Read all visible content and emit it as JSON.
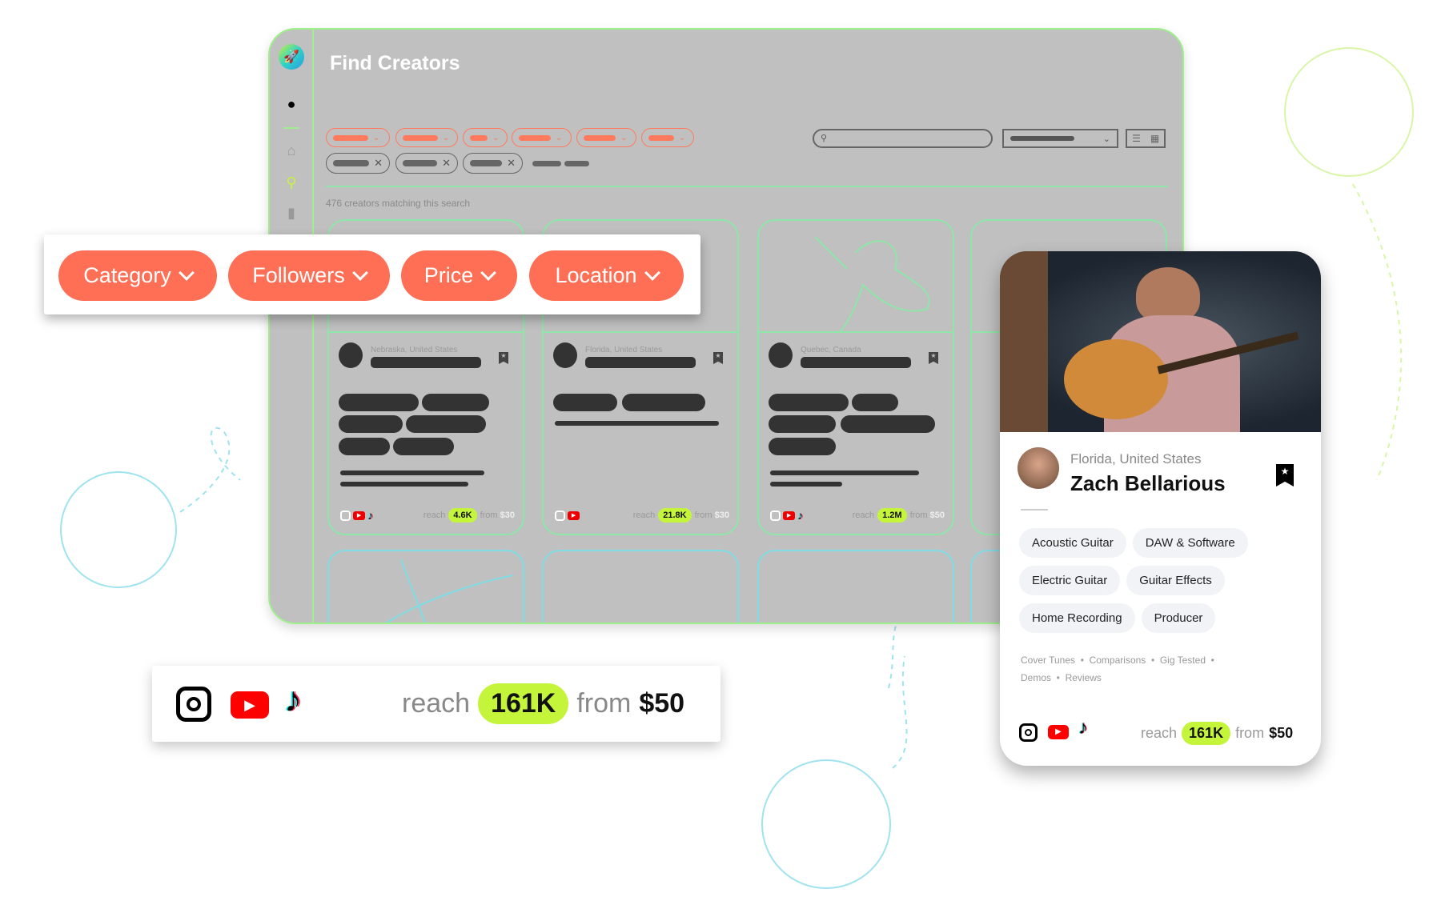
{
  "app": {
    "title": "Find Creators",
    "results_count": "476 creators matching this search"
  },
  "sidebar": {
    "items": [
      {
        "icon": "rocket-logo-icon"
      },
      {
        "icon": "guitar-icon"
      },
      {
        "icon": "home-icon"
      },
      {
        "icon": "search-icon"
      },
      {
        "icon": "bookmark-icon"
      }
    ]
  },
  "filters": [
    {
      "label": "Category"
    },
    {
      "label": "Followers"
    },
    {
      "label": "Price"
    },
    {
      "label": "Location"
    }
  ],
  "grid_cards": [
    {
      "location": "Nebraska, United States",
      "reach": "4.6K",
      "from_label": "from",
      "price": "$30",
      "reach_label": "reach",
      "platforms": [
        "instagram",
        "youtube",
        "tiktok"
      ]
    },
    {
      "location": "Florida, United States",
      "reach": "21.8K",
      "from_label": "from",
      "price": "$30",
      "reach_label": "reach",
      "platforms": [
        "instagram",
        "youtube"
      ]
    },
    {
      "location": "Quebec, Canada",
      "reach": "1.2M",
      "from_label": "from",
      "price": "$50",
      "reach_label": "reach",
      "platforms": [
        "instagram",
        "youtube",
        "tiktok"
      ]
    }
  ],
  "social_callout": {
    "reach_label": "reach",
    "reach": "161K",
    "from_label": "from",
    "price": "$50",
    "platforms": [
      "instagram",
      "youtube",
      "tiktok"
    ]
  },
  "profile": {
    "location": "Florida, United States",
    "name": "Zach Bellarious",
    "tags": [
      "Acoustic Guitar",
      "DAW & Software",
      "Electric Guitar",
      "Guitar Effects",
      "Home Recording",
      "Producer"
    ],
    "content_types": [
      "Cover Tunes",
      "Comparisons",
      "Gig Tested",
      "Demos",
      "Reviews"
    ],
    "reach_label": "reach",
    "reach": "161K",
    "from_label": "from",
    "price": "$50"
  },
  "colors": {
    "accent": "#ff6f55",
    "reach_badge": "#c5f53a",
    "panel": "#c0c0c0",
    "border_green": "#9ef08a",
    "line_art": "#7fdde6"
  }
}
